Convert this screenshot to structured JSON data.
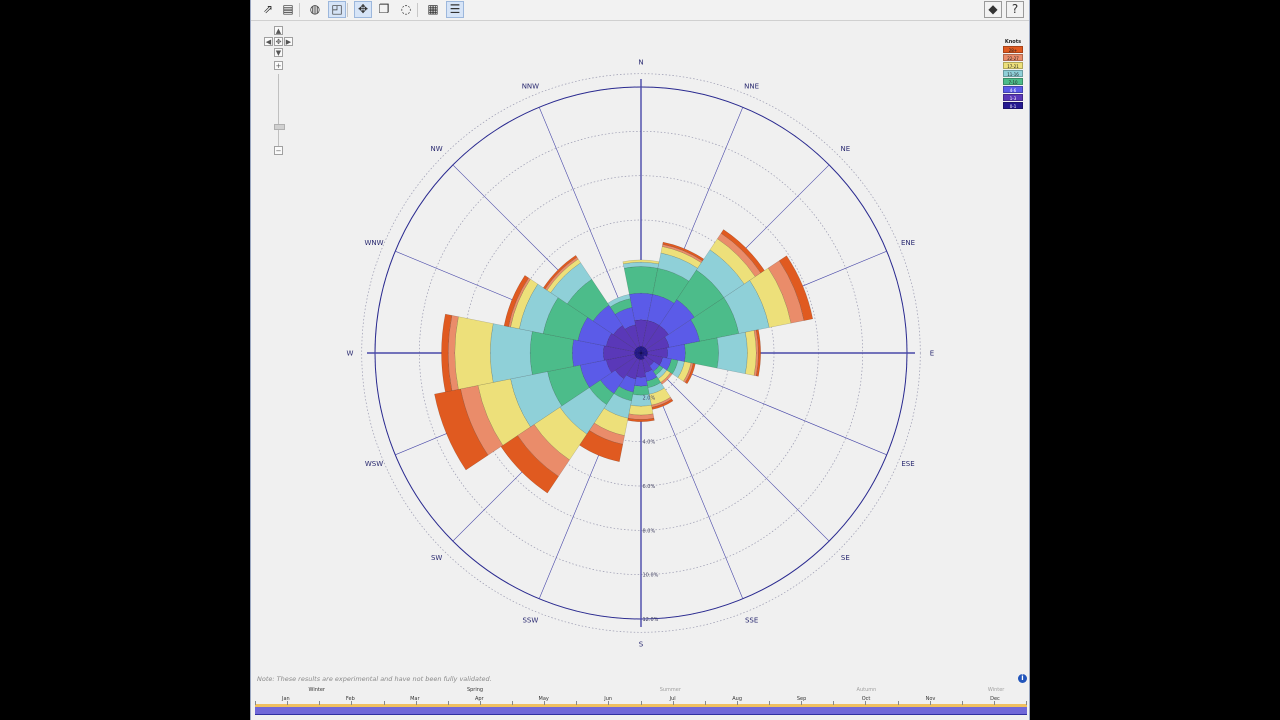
{
  "toolbar": {
    "buttons": [
      {
        "name": "open-icon",
        "glyph": "⇗"
      },
      {
        "name": "save-icon",
        "glyph": "▤"
      },
      {
        "name": "globe-icon",
        "glyph": "◍"
      },
      {
        "name": "cube-icon",
        "glyph": "◰"
      },
      {
        "name": "pan-icon",
        "glyph": "✥"
      },
      {
        "name": "layers-icon",
        "glyph": "❐"
      },
      {
        "name": "marker-icon",
        "glyph": "◌"
      },
      {
        "name": "image-icon",
        "glyph": "▦"
      },
      {
        "name": "list-icon",
        "glyph": "☰"
      }
    ],
    "right": [
      {
        "name": "cube-arrow-icon",
        "glyph": "◆"
      },
      {
        "name": "help-icon",
        "glyph": "?"
      }
    ]
  },
  "zoom": {
    "plus": "+",
    "minus": "−"
  },
  "legend": {
    "title": "Knots",
    "bins": [
      {
        "label": "28+",
        "color": "#e05a20"
      },
      {
        "label": "22-27",
        "color": "#ea8c6a"
      },
      {
        "label": "17-21",
        "color": "#ede07a"
      },
      {
        "label": "11-16",
        "color": "#8fd0d8"
      },
      {
        "label": "7-10",
        "color": "#4cbc8a"
      },
      {
        "label": "4-6",
        "color": "#5b5be8"
      },
      {
        "label": "1-3",
        "color": "#5a38b8"
      },
      {
        "label": "0-1",
        "color": "#241890"
      }
    ]
  },
  "chart_data": {
    "type": "windrose",
    "unit": "%",
    "directions": [
      "N",
      "NNE",
      "NE",
      "ENE",
      "E",
      "ESE",
      "SE",
      "SSE",
      "S",
      "SSW",
      "SW",
      "WSW",
      "W",
      "WNW",
      "NW",
      "NNW"
    ],
    "radial_ticks": [
      2.0,
      4.0,
      6.0,
      8.0,
      10.0,
      12.0
    ],
    "radial_tick_labels": [
      "2.0%",
      "4.0%",
      "6.0%",
      "8.0%",
      "10.0%",
      "12.0%"
    ],
    "rmax": 12.0,
    "speed_bins": [
      "0-1",
      "1-3",
      "4-6",
      "7-10",
      "11-16",
      "17-21",
      "22-27",
      "28+"
    ],
    "series": [
      {
        "name": "0-1",
        "values": [
          0.3,
          0.3,
          0.3,
          0.3,
          0.3,
          0.3,
          0.2,
          0.3,
          0.3,
          0.3,
          0.3,
          0.3,
          0.3,
          0.3,
          0.3,
          0.3
        ]
      },
      {
        "name": "1-3",
        "values": [
          1.2,
          1.2,
          1.2,
          1.0,
          0.9,
          0.7,
          0.5,
          0.6,
          0.8,
          0.9,
          1.1,
          1.3,
          1.4,
          1.3,
          1.2,
          1.0
        ]
      },
      {
        "name": "4-6",
        "values": [
          1.2,
          1.2,
          1.4,
          1.4,
          0.8,
          0.4,
          0.3,
          0.4,
          0.4,
          0.6,
          0.8,
          1.2,
          1.4,
          1.3,
          1.1,
          0.8
        ]
      },
      {
        "name": "7-10",
        "values": [
          1.2,
          1.2,
          1.6,
          1.8,
          1.5,
          0.3,
          0.2,
          0.3,
          0.4,
          0.4,
          0.6,
          1.5,
          1.9,
          1.6,
          1.4,
          0.4
        ]
      },
      {
        "name": "11-16",
        "values": [
          0.2,
          0.7,
          1.1,
          1.4,
          1.3,
          0.3,
          0.2,
          0.3,
          0.5,
          0.8,
          1.6,
          1.7,
          1.8,
          1.1,
          0.9,
          0.2
        ]
      },
      {
        "name": "17-21",
        "values": [
          0.1,
          0.3,
          0.6,
          1.0,
          0.4,
          0.3,
          0.2,
          0.5,
          0.4,
          0.8,
          1.4,
          1.5,
          1.6,
          0.4,
          0.2,
          0.0
        ]
      },
      {
        "name": "22-27",
        "values": [
          0.0,
          0.1,
          0.3,
          0.6,
          0.1,
          0.1,
          0.1,
          0.1,
          0.2,
          0.4,
          0.9,
          0.8,
          0.3,
          0.1,
          0.1,
          0.0
        ]
      },
      {
        "name": "28+",
        "values": [
          0.0,
          0.1,
          0.2,
          0.4,
          0.1,
          0.1,
          0.0,
          0.1,
          0.1,
          0.8,
          0.9,
          1.2,
          0.3,
          0.2,
          0.1,
          0.0
        ]
      }
    ]
  },
  "note": "Note: These results are experimental and have not been fully validated.",
  "timeline": {
    "seasons": [
      {
        "label": "Winter",
        "faded": false
      },
      {
        "label": "Spring",
        "faded": false
      },
      {
        "label": "Summer",
        "faded": true
      },
      {
        "label": "Autumn",
        "faded": true
      },
      {
        "label": "Winter",
        "faded": true
      }
    ],
    "months": [
      "Jan",
      "Feb",
      "Mar",
      "Apr",
      "May",
      "Jun",
      "Jul",
      "Aug",
      "Sep",
      "Oct",
      "Nov",
      "Dec"
    ]
  }
}
